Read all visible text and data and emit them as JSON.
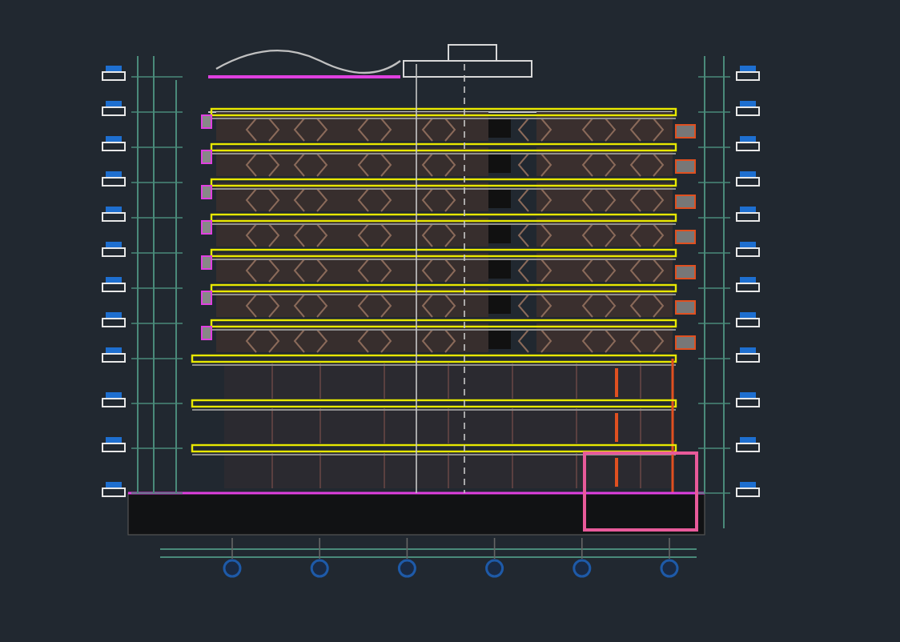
{
  "section": {
    "floors": [
      {
        "kind": "roof"
      },
      {
        "kind": "typical"
      },
      {
        "kind": "typical"
      },
      {
        "kind": "typical"
      },
      {
        "kind": "typical"
      },
      {
        "kind": "typical"
      },
      {
        "kind": "typical"
      },
      {
        "kind": "typical"
      },
      {
        "kind": "podium"
      },
      {
        "kind": "podium"
      },
      {
        "kind": "podium"
      },
      {
        "kind": "ground"
      }
    ],
    "grid_axes": [
      {
        "kind": "axis"
      },
      {
        "kind": "axis"
      },
      {
        "kind": "axis"
      },
      {
        "kind": "axis"
      },
      {
        "kind": "axis"
      },
      {
        "kind": "axis"
      }
    ]
  }
}
